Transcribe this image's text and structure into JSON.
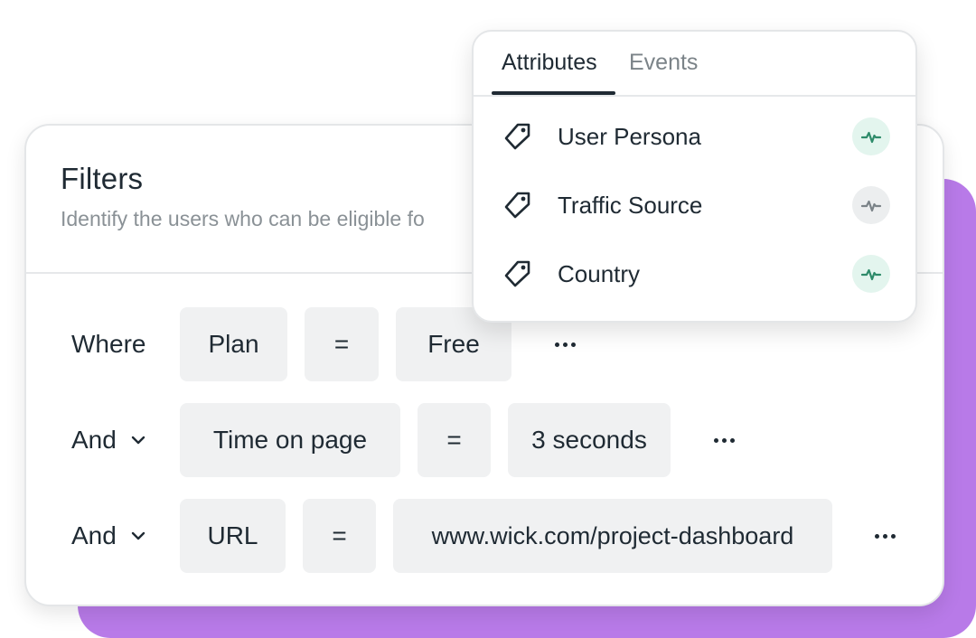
{
  "filters": {
    "title": "Filters",
    "subtitle": "Identify the users who can be eligible fo",
    "rows": [
      {
        "connector": "Where",
        "attribute": "Plan",
        "operator": "=",
        "value": "Free"
      },
      {
        "connector": "And",
        "attribute": "Time on page",
        "operator": "=",
        "value": "3 seconds"
      },
      {
        "connector": "And",
        "attribute": "URL",
        "operator": "=",
        "value": "www.wick.com/project-dashboard"
      }
    ]
  },
  "dropdown": {
    "tabs": [
      "Attributes",
      "Events"
    ],
    "active_tab": "Attributes",
    "items": [
      {
        "label": "User Persona",
        "icon": "tag-icon",
        "status_icon": "activity-icon",
        "status": "active"
      },
      {
        "label": "Traffic Source",
        "icon": "tag-icon",
        "status_icon": "activity-icon",
        "status": "inactive"
      },
      {
        "label": "Country",
        "icon": "tag-icon",
        "status_icon": "activity-icon",
        "status": "active"
      }
    ]
  },
  "colors": {
    "accent_purple": "#b87ae8",
    "active_green": "#2e8b6a",
    "active_green_bg": "#e3f5ee",
    "inactive_gray": "#7b8388",
    "inactive_gray_bg": "#eceeef",
    "chip_bg": "#f0f1f2",
    "text_dark": "#1f2a33"
  }
}
